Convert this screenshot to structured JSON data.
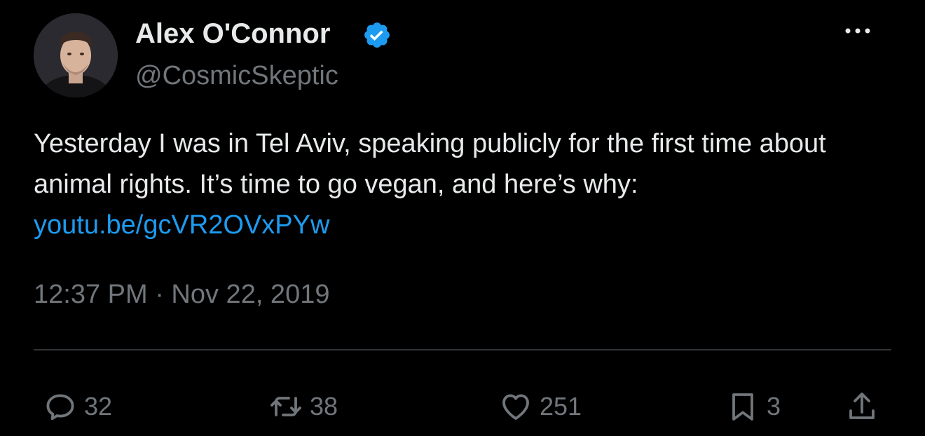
{
  "author": {
    "display_name": "Alex O'Connor",
    "handle": "@CosmicSkeptic",
    "verified": true,
    "avatar_icon": "profile-photo"
  },
  "tweet": {
    "text_main": "Yesterday I was in Tel Aviv, speaking publicly for the first time about animal rights. It’s time to go vegan, and here’s why: ",
    "link_text": "youtu.be/gcVR2OVxPYw",
    "timestamp": "12:37 PM · Nov 22, 2019"
  },
  "actions": {
    "replies": "32",
    "retweets": "38",
    "likes": "251",
    "bookmarks": "3"
  },
  "colors": {
    "background": "#000000",
    "text_primary": "#e7e9ea",
    "text_secondary": "#71767b",
    "link": "#1d9bf0",
    "verified_badge": "#1d9bf0",
    "divider": "#2f3336"
  }
}
